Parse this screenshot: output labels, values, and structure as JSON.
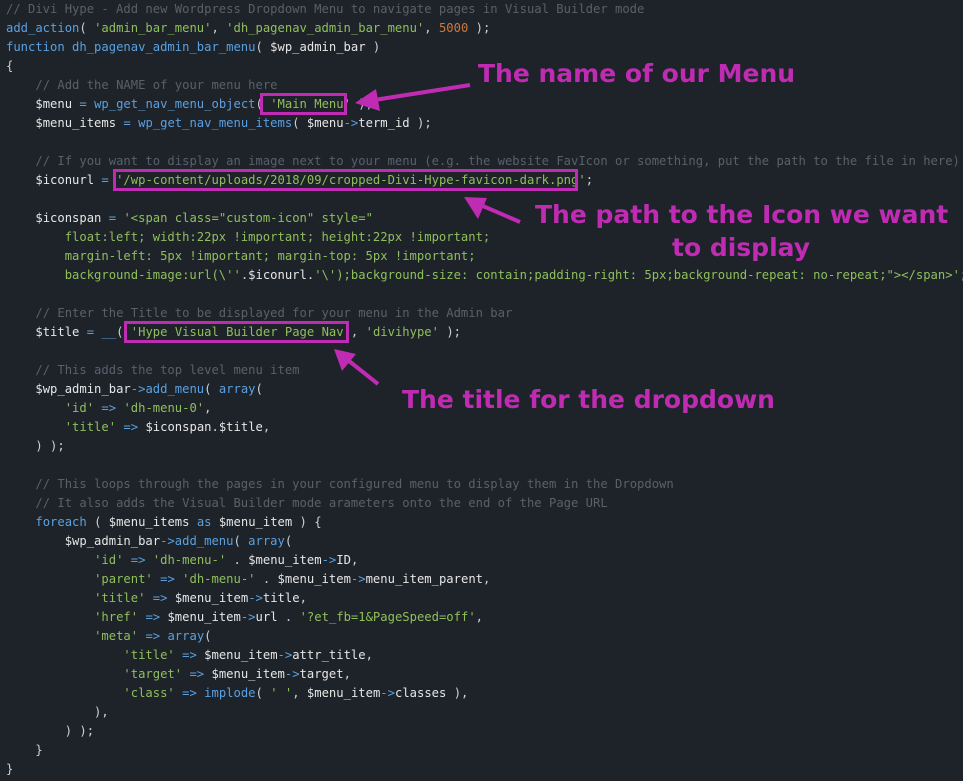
{
  "code_lines": [
    [
      [
        "cmt",
        "// Divi Hype - Add new Wordpress Dropdown Menu to navigate pages in Visual Builder mode"
      ]
    ],
    [
      [
        "fn",
        "add_action"
      ],
      [
        "p",
        "( "
      ],
      [
        "str",
        "'admin_bar_menu'"
      ],
      [
        "p",
        ", "
      ],
      [
        "str",
        "'dh_pagenav_admin_bar_menu'"
      ],
      [
        "p",
        ", "
      ],
      [
        "num",
        "5000"
      ],
      [
        "p",
        " );"
      ]
    ],
    [
      [
        "kw",
        "function"
      ],
      [
        "p",
        " "
      ],
      [
        "fn",
        "dh_pagenav_admin_bar_menu"
      ],
      [
        "p",
        "( "
      ],
      [
        "var",
        "$wp_admin_bar"
      ],
      [
        "p",
        " )"
      ]
    ],
    [
      [
        "p",
        "{"
      ]
    ],
    [
      [
        "p",
        "    "
      ],
      [
        "cmt",
        "// Add the NAME of your menu here"
      ]
    ],
    [
      [
        "p",
        "    "
      ],
      [
        "var",
        "$menu"
      ],
      [
        "p",
        " "
      ],
      [
        "op",
        "="
      ],
      [
        "p",
        " "
      ],
      [
        "fn",
        "wp_get_nav_menu_object"
      ],
      [
        "p",
        "( "
      ],
      [
        "str",
        "'Main Menu'"
      ],
      [
        "p",
        " );"
      ]
    ],
    [
      [
        "p",
        "    "
      ],
      [
        "var",
        "$menu_items"
      ],
      [
        "p",
        " "
      ],
      [
        "op",
        "="
      ],
      [
        "p",
        " "
      ],
      [
        "fn",
        "wp_get_nav_menu_items"
      ],
      [
        "p",
        "( "
      ],
      [
        "var",
        "$menu"
      ],
      [
        "op",
        "->"
      ],
      [
        "var",
        "term_id"
      ],
      [
        "p",
        " );"
      ]
    ],
    [
      [
        "p",
        ""
      ]
    ],
    [
      [
        "p",
        "    "
      ],
      [
        "cmt",
        "// If you want to display an image next to your menu (e.g. the website FavIcon or something, put the path to the file in here)"
      ]
    ],
    [
      [
        "p",
        "    "
      ],
      [
        "var",
        "$iconurl"
      ],
      [
        "p",
        " "
      ],
      [
        "op",
        "="
      ],
      [
        "p",
        " "
      ],
      [
        "str",
        "'/wp-content/uploads/2018/09/cropped-Divi-Hype-favicon-dark.png'"
      ],
      [
        "p",
        ";"
      ]
    ],
    [
      [
        "p",
        ""
      ]
    ],
    [
      [
        "p",
        "    "
      ],
      [
        "var",
        "$iconspan"
      ],
      [
        "p",
        " "
      ],
      [
        "op",
        "="
      ],
      [
        "p",
        " "
      ],
      [
        "str",
        "'<span class=\"custom-icon\" style=\""
      ]
    ],
    [
      [
        "str",
        "        float:left; width:22px !important; height:22px !important;"
      ]
    ],
    [
      [
        "str",
        "        margin-left: 5px !important; margin-top: 5px !important;"
      ]
    ],
    [
      [
        "str",
        "        background-image:url(\\''"
      ],
      [
        "p",
        "."
      ],
      [
        "var",
        "$iconurl"
      ],
      [
        "p",
        "."
      ],
      [
        "str",
        "'\\');background-size: contain;padding-right: 5px;background-repeat: no-repeat;\"></span>'"
      ],
      [
        "p",
        ";"
      ]
    ],
    [
      [
        "p",
        ""
      ]
    ],
    [
      [
        "p",
        "    "
      ],
      [
        "cmt",
        "// Enter the Title to be displayed for your menu in the Admin bar"
      ]
    ],
    [
      [
        "p",
        "    "
      ],
      [
        "var",
        "$title"
      ],
      [
        "p",
        " "
      ],
      [
        "op",
        "="
      ],
      [
        "p",
        " "
      ],
      [
        "fn",
        "__"
      ],
      [
        "p",
        "( "
      ],
      [
        "str",
        "'Hype Visual Builder Page Nav'"
      ],
      [
        "p",
        ", "
      ],
      [
        "str",
        "'divihype'"
      ],
      [
        "p",
        " );"
      ]
    ],
    [
      [
        "p",
        ""
      ]
    ],
    [
      [
        "p",
        "    "
      ],
      [
        "cmt",
        "// This adds the top level menu item"
      ]
    ],
    [
      [
        "p",
        "    "
      ],
      [
        "var",
        "$wp_admin_bar"
      ],
      [
        "op",
        "->"
      ],
      [
        "fn",
        "add_menu"
      ],
      [
        "p",
        "( "
      ],
      [
        "kw",
        "array"
      ],
      [
        "p",
        "("
      ]
    ],
    [
      [
        "p",
        "        "
      ],
      [
        "str",
        "'id'"
      ],
      [
        "p",
        " "
      ],
      [
        "op",
        "=>"
      ],
      [
        "p",
        " "
      ],
      [
        "str",
        "'dh-menu-0'"
      ],
      [
        "p",
        ","
      ]
    ],
    [
      [
        "p",
        "        "
      ],
      [
        "str",
        "'title'"
      ],
      [
        "p",
        " "
      ],
      [
        "op",
        "=>"
      ],
      [
        "p",
        " "
      ],
      [
        "var",
        "$iconspan"
      ],
      [
        "p",
        "."
      ],
      [
        "var",
        "$title"
      ],
      [
        "p",
        ","
      ]
    ],
    [
      [
        "p",
        "    ) );"
      ]
    ],
    [
      [
        "p",
        ""
      ]
    ],
    [
      [
        "p",
        "    "
      ],
      [
        "cmt",
        "// This loops through the pages in your configured menu to display them in the Dropdown"
      ]
    ],
    [
      [
        "p",
        "    "
      ],
      [
        "cmt",
        "// It also adds the Visual Builder mode arameters onto the end of the Page URL"
      ]
    ],
    [
      [
        "p",
        "    "
      ],
      [
        "kw",
        "foreach"
      ],
      [
        "p",
        " ( "
      ],
      [
        "var",
        "$menu_items"
      ],
      [
        "p",
        " "
      ],
      [
        "kw",
        "as"
      ],
      [
        "p",
        " "
      ],
      [
        "var",
        "$menu_item"
      ],
      [
        "p",
        " ) {"
      ]
    ],
    [
      [
        "p",
        "        "
      ],
      [
        "var",
        "$wp_admin_bar"
      ],
      [
        "op",
        "->"
      ],
      [
        "fn",
        "add_menu"
      ],
      [
        "p",
        "( "
      ],
      [
        "kw",
        "array"
      ],
      [
        "p",
        "("
      ]
    ],
    [
      [
        "p",
        "            "
      ],
      [
        "str",
        "'id'"
      ],
      [
        "p",
        " "
      ],
      [
        "op",
        "=>"
      ],
      [
        "p",
        " "
      ],
      [
        "str",
        "'dh-menu-'"
      ],
      [
        "p",
        " . "
      ],
      [
        "var",
        "$menu_item"
      ],
      [
        "op",
        "->"
      ],
      [
        "var",
        "ID"
      ],
      [
        "p",
        ","
      ]
    ],
    [
      [
        "p",
        "            "
      ],
      [
        "str",
        "'parent'"
      ],
      [
        "p",
        " "
      ],
      [
        "op",
        "=>"
      ],
      [
        "p",
        " "
      ],
      [
        "str",
        "'dh-menu-'"
      ],
      [
        "p",
        " . "
      ],
      [
        "var",
        "$menu_item"
      ],
      [
        "op",
        "->"
      ],
      [
        "var",
        "menu_item_parent"
      ],
      [
        "p",
        ","
      ]
    ],
    [
      [
        "p",
        "            "
      ],
      [
        "str",
        "'title'"
      ],
      [
        "p",
        " "
      ],
      [
        "op",
        "=>"
      ],
      [
        "p",
        " "
      ],
      [
        "var",
        "$menu_item"
      ],
      [
        "op",
        "->"
      ],
      [
        "var",
        "title"
      ],
      [
        "p",
        ","
      ]
    ],
    [
      [
        "p",
        "            "
      ],
      [
        "str",
        "'href'"
      ],
      [
        "p",
        " "
      ],
      [
        "op",
        "=>"
      ],
      [
        "p",
        " "
      ],
      [
        "var",
        "$menu_item"
      ],
      [
        "op",
        "->"
      ],
      [
        "var",
        "url"
      ],
      [
        "p",
        " . "
      ],
      [
        "str",
        "'?et_fb=1&PageSpeed=off'"
      ],
      [
        "p",
        ","
      ]
    ],
    [
      [
        "p",
        "            "
      ],
      [
        "str",
        "'meta'"
      ],
      [
        "p",
        " "
      ],
      [
        "op",
        "=>"
      ],
      [
        "p",
        " "
      ],
      [
        "kw",
        "array"
      ],
      [
        "p",
        "("
      ]
    ],
    [
      [
        "p",
        "                "
      ],
      [
        "str",
        "'title'"
      ],
      [
        "p",
        " "
      ],
      [
        "op",
        "=>"
      ],
      [
        "p",
        " "
      ],
      [
        "var",
        "$menu_item"
      ],
      [
        "op",
        "->"
      ],
      [
        "var",
        "attr_title"
      ],
      [
        "p",
        ","
      ]
    ],
    [
      [
        "p",
        "                "
      ],
      [
        "str",
        "'target'"
      ],
      [
        "p",
        " "
      ],
      [
        "op",
        "=>"
      ],
      [
        "p",
        " "
      ],
      [
        "var",
        "$menu_item"
      ],
      [
        "op",
        "->"
      ],
      [
        "var",
        "target"
      ],
      [
        "p",
        ","
      ]
    ],
    [
      [
        "p",
        "                "
      ],
      [
        "str",
        "'class'"
      ],
      [
        "p",
        " "
      ],
      [
        "op",
        "=>"
      ],
      [
        "p",
        " "
      ],
      [
        "fn",
        "implode"
      ],
      [
        "p",
        "( "
      ],
      [
        "str",
        "' '"
      ],
      [
        "p",
        ", "
      ],
      [
        "var",
        "$menu_item"
      ],
      [
        "op",
        "->"
      ],
      [
        "var",
        "classes"
      ],
      [
        "p",
        " ),"
      ]
    ],
    [
      [
        "p",
        "            ),"
      ]
    ],
    [
      [
        "p",
        "        ) );"
      ]
    ],
    [
      [
        "p",
        "    }"
      ]
    ],
    [
      [
        "p",
        "}"
      ]
    ]
  ],
  "colors": {
    "background": "#1e2329",
    "accent": "#c02bb3",
    "comment": "#58606b",
    "keyword": "#5aa0e0",
    "string": "#8fbf5c",
    "number": "#d0773a",
    "variable": "#e6e6e6"
  },
  "annotations": {
    "menu_name": "The name of our Menu",
    "icon_path_line1": "The path to the Icon we want",
    "icon_path_line2": "to display",
    "dropdown_title": "The title for the dropdown"
  }
}
